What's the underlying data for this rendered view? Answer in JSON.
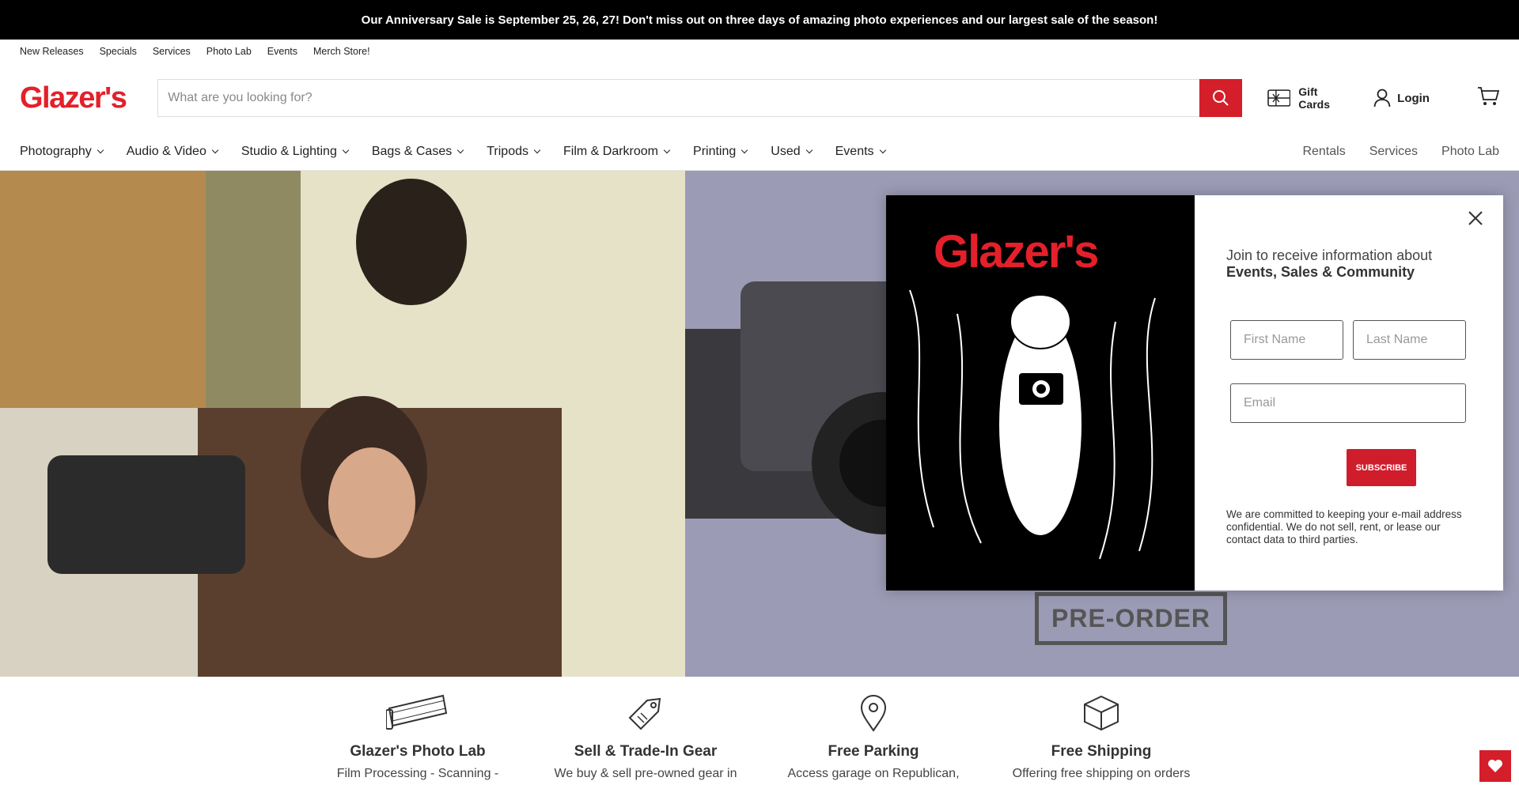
{
  "announcement": "Our Anniversary Sale is September 25, 26, 27! Don't miss out on three days of amazing photo experiences and our largest sale of the season!",
  "utility_links": [
    "New Releases",
    "Specials",
    "Services",
    "Photo Lab",
    "Events",
    "Merch Store!"
  ],
  "logo": "Glazer's",
  "search": {
    "placeholder": "What are you looking for?"
  },
  "header": {
    "gift_cards": "Gift Cards",
    "login": "Login"
  },
  "nav": {
    "left": [
      "Photography",
      "Audio & Video",
      "Studio & Lighting",
      "Bags & Cases",
      "Tripods",
      "Film & Darkroom",
      "Printing",
      "Used",
      "Events"
    ],
    "right": [
      "Rentals",
      "Services",
      "Photo Lab"
    ]
  },
  "hero": {
    "badge": "PRE-ORDER"
  },
  "modal": {
    "logo": "Glazer's",
    "title_line1": "Join to receive information about",
    "title_line2": "Events, Sales & Community",
    "first_name_placeholder": "First Name",
    "last_name_placeholder": "Last Name",
    "email_placeholder": "Email",
    "subscribe_label": "SUBSCRIBE",
    "privacy": "We are committed to keeping your e-mail address confidential. We do not sell, rent, or lease our contact data to third parties."
  },
  "features": [
    {
      "title": "Glazer's Photo Lab",
      "desc": "Film Processing - Scanning -"
    },
    {
      "title": "Sell & Trade-In Gear",
      "desc": "We buy & sell pre-owned gear in"
    },
    {
      "title": "Free Parking",
      "desc": "Access garage on Republican,"
    },
    {
      "title": "Free Shipping",
      "desc": "Offering free shipping on orders"
    }
  ],
  "colors": {
    "brand_red": "#e4202a",
    "button_red": "#d41e2a"
  }
}
